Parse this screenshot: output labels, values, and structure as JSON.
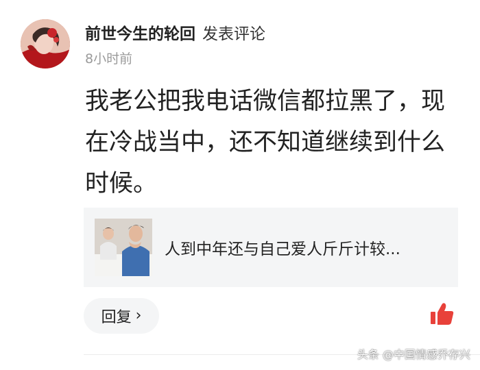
{
  "comment": {
    "author_name": "前世今生的轮回",
    "action_label": "发表评论",
    "timestamp": "8小时前",
    "text": "我老公把我电话微信都拉黑了，现在冷战当中，还不知道继续到什么时候。"
  },
  "linked_article": {
    "title": "人到中年还与自己爱人斤斤计较..."
  },
  "actions": {
    "reply_label": "回复",
    "reply_chevron": "›",
    "like_icon": "thumbs-up-icon"
  },
  "watermark": "头条 @中国情感乔存兴",
  "colors": {
    "text_primary": "#222222",
    "text_secondary": "#9a9a9a",
    "card_background": "#f4f5f6",
    "like_red": "#e8413a"
  }
}
